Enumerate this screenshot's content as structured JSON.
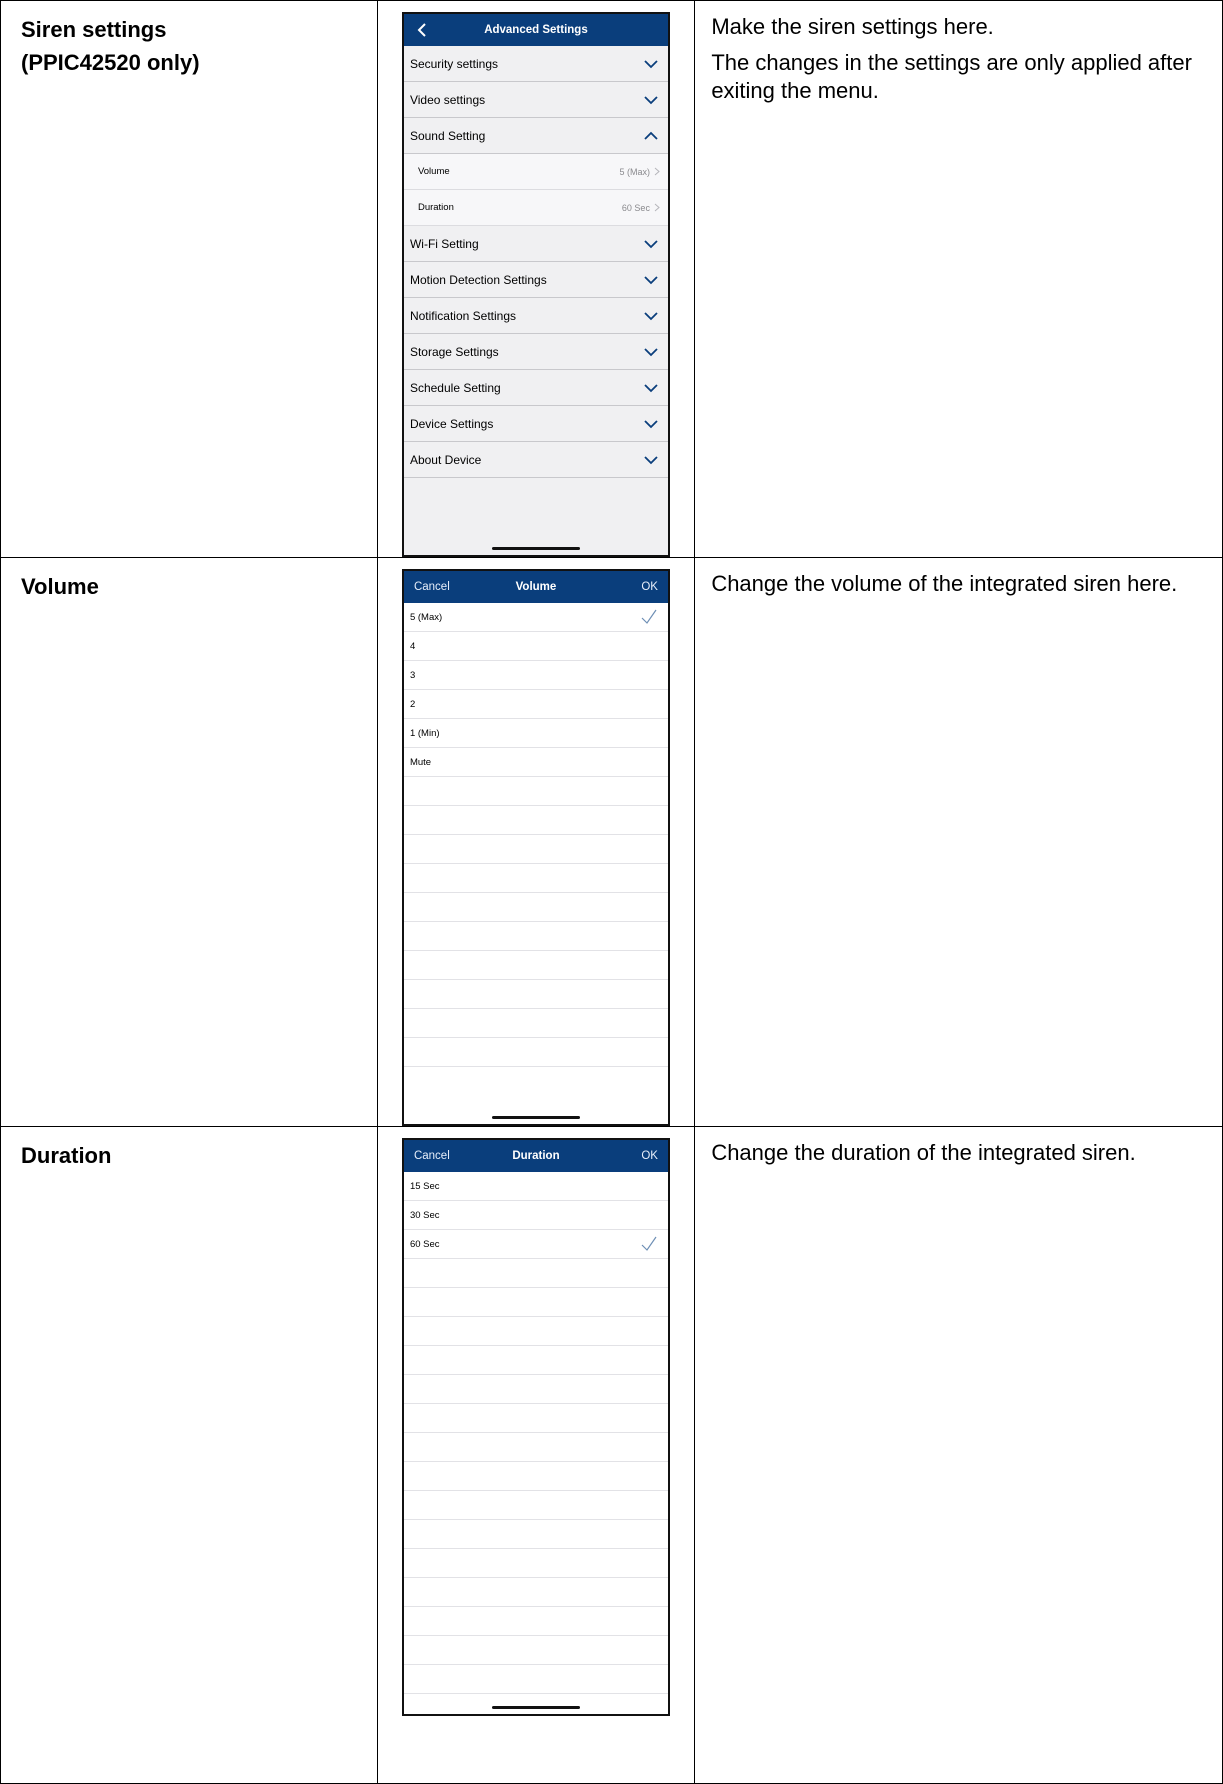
{
  "rows": [
    {
      "title_lines": [
        "Siren settings",
        "(PPIC42520 only)"
      ],
      "description": [
        "Make the siren settings here.",
        "The changes in the settings are only applied after exiting the menu."
      ]
    },
    {
      "title_lines": [
        "Volume"
      ],
      "description": [
        "Change the volume of the integrated siren here."
      ]
    },
    {
      "title_lines": [
        "Duration"
      ],
      "description": [
        "Change the duration of the integrated siren."
      ]
    }
  ],
  "screen_advanced": {
    "title": "Advanced Settings",
    "items": [
      {
        "label": "Security settings",
        "expanded": false
      },
      {
        "label": "Video settings",
        "expanded": false
      },
      {
        "label": "Sound Setting",
        "expanded": true
      },
      {
        "label": "Wi-Fi Setting",
        "expanded": false
      },
      {
        "label": "Motion Detection Settings",
        "expanded": false
      },
      {
        "label": "Notification Settings",
        "expanded": false
      },
      {
        "label": "Storage Settings",
        "expanded": false
      },
      {
        "label": "Schedule Setting",
        "expanded": false
      },
      {
        "label": "Device Settings",
        "expanded": false
      },
      {
        "label": "About Device",
        "expanded": false
      }
    ],
    "sound_subitems": [
      {
        "label": "Volume",
        "value": "5 (Max)"
      },
      {
        "label": "Duration",
        "value": "60 Sec"
      }
    ]
  },
  "screen_volume": {
    "cancel": "Cancel",
    "title": "Volume",
    "ok": "OK",
    "options": [
      "5 (Max)",
      "4",
      "3",
      "2",
      "1 (Min)",
      "Mute"
    ],
    "selected": "5 (Max)"
  },
  "screen_duration": {
    "cancel": "Cancel",
    "title": "Duration",
    "ok": "OK",
    "options": [
      "15 Sec",
      "30 Sec",
      "60 Sec"
    ],
    "selected": "60 Sec"
  },
  "colors": {
    "navbar": "#0a3e7c",
    "chevron": "#0a3e7c",
    "checkmark": "#6e8fb5"
  },
  "icons": {
    "back": "chevron-left-icon",
    "expand": "chevron-down-icon",
    "collapse": "chevron-up-icon",
    "disclosure": "chevron-right-icon",
    "selected": "checkmark-icon"
  }
}
